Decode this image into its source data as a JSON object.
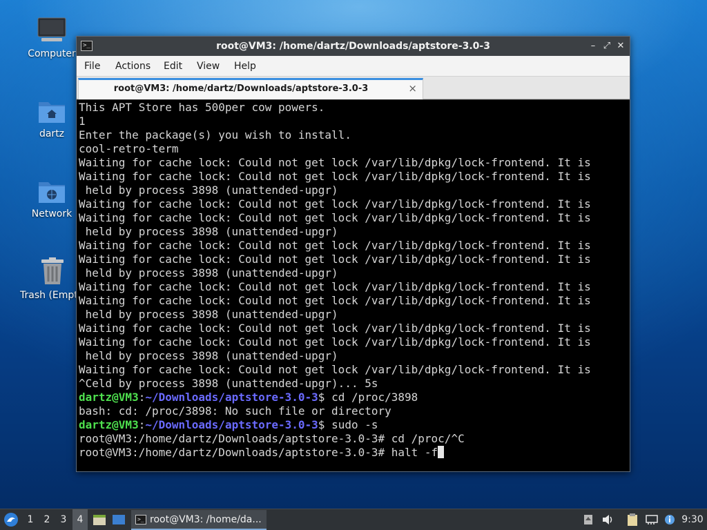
{
  "desktop": {
    "icons": [
      {
        "label": "Computer"
      },
      {
        "label": "dartz"
      },
      {
        "label": "Network"
      },
      {
        "label": "Trash (Empty)"
      }
    ]
  },
  "window": {
    "title": "root@VM3: /home/dartz/Downloads/aptstore-3.0-3",
    "title_icon": ">_",
    "controls": {
      "minimize": "–",
      "maximize": "⤢",
      "close": "✕"
    },
    "menu": [
      "File",
      "Actions",
      "Edit",
      "View",
      "Help"
    ],
    "tab": {
      "label": "root@VM3: /home/dartz/Downloads/aptstore-3.0-3",
      "close": "×"
    }
  },
  "terminal": {
    "lines": [
      "This APT Store has 500per cow powers.",
      "1",
      "Enter the package(s) you wish to install.",
      "cool-retro-term",
      "Waiting for cache lock: Could not get lock /var/lib/dpkg/lock-frontend. It is",
      "Waiting for cache lock: Could not get lock /var/lib/dpkg/lock-frontend. It is",
      " held by process 3898 (unattended-upgr)",
      "Waiting for cache lock: Could not get lock /var/lib/dpkg/lock-frontend. It is",
      "Waiting for cache lock: Could not get lock /var/lib/dpkg/lock-frontend. It is",
      " held by process 3898 (unattended-upgr)",
      "Waiting for cache lock: Could not get lock /var/lib/dpkg/lock-frontend. It is",
      "Waiting for cache lock: Could not get lock /var/lib/dpkg/lock-frontend. It is",
      " held by process 3898 (unattended-upgr)",
      "Waiting for cache lock: Could not get lock /var/lib/dpkg/lock-frontend. It is",
      "Waiting for cache lock: Could not get lock /var/lib/dpkg/lock-frontend. It is",
      " held by process 3898 (unattended-upgr)",
      "Waiting for cache lock: Could not get lock /var/lib/dpkg/lock-frontend. It is",
      "Waiting for cache lock: Could not get lock /var/lib/dpkg/lock-frontend. It is",
      " held by process 3898 (unattended-upgr)",
      "Waiting for cache lock: Could not get lock /var/lib/dpkg/lock-frontend. It is",
      "^Celd by process 3898 (unattended-upgr)... 5s"
    ],
    "prompt_user": "dartz@VM3",
    "prompt_path": "~/Downloads/aptstore-3.0-3",
    "cmd1": "$ cd /proc/3898",
    "out1": "bash: cd: /proc/3898: No such file or directory",
    "cmd2": "$ sudo -s",
    "root_line1": "root@VM3:/home/dartz/Downloads/aptstore-3.0-3# cd /proc/^C",
    "root_line2": "root@VM3:/home/dartz/Downloads/aptstore-3.0-3# halt -f"
  },
  "taskbar": {
    "workspaces": [
      "1",
      "2",
      "3",
      "4"
    ],
    "active_workspace": "4",
    "task_label": "root@VM3: /home/da...",
    "clock": "9:30",
    "colors": {
      "accent": "#7ea9d8",
      "prompt_user": "#4ee04e",
      "prompt_path": "#6a6aff"
    }
  }
}
